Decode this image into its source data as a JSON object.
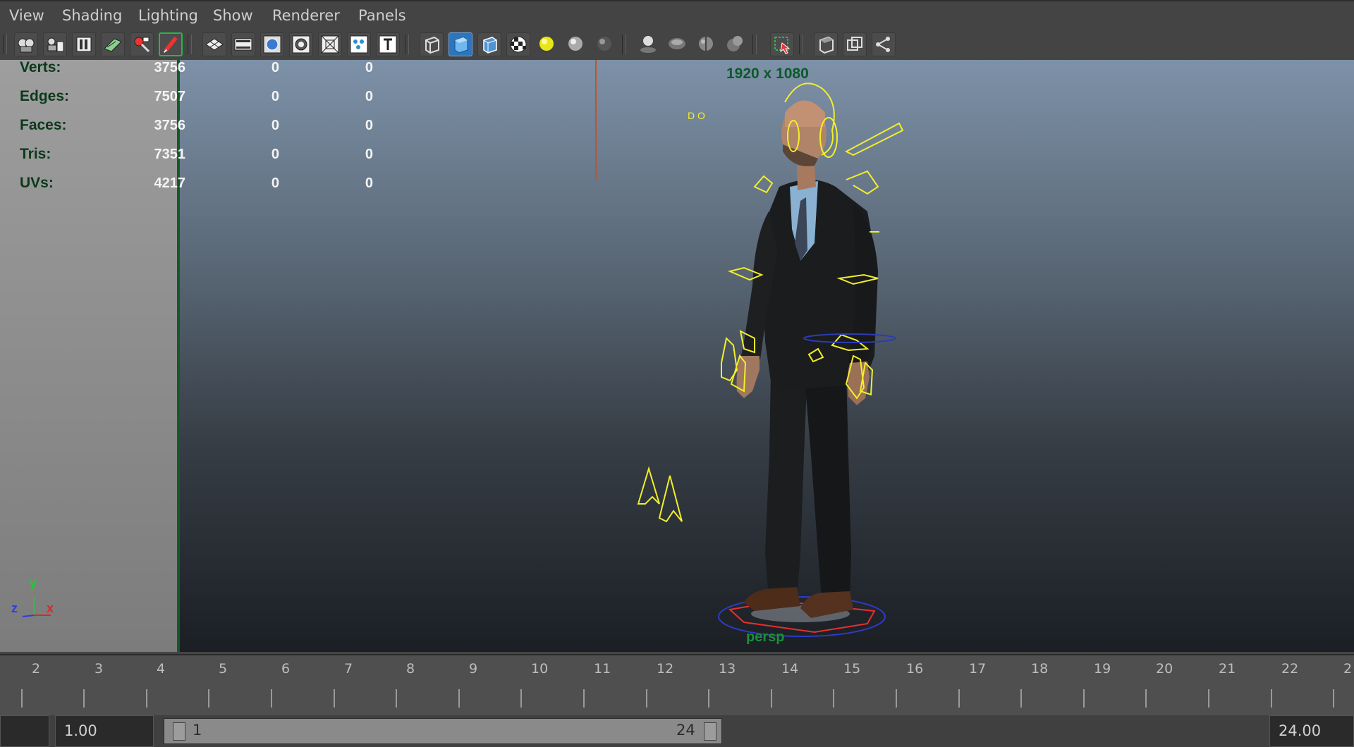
{
  "menu": [
    "View",
    "Shading",
    "Lighting",
    "Show",
    "Renderer",
    "Panels"
  ],
  "toolbar_icons": [
    "select-camera-icon",
    "camera-attributes-icon",
    "bookmarks-icon",
    "image-plane-icon",
    "2d-pan-zoom-icon",
    "grease-pencil-icon",
    "grid-icon",
    "film-gate-icon",
    "resolution-gate-icon",
    "gate-mask-icon",
    "field-chart-icon",
    "safe-action-icon",
    "safe-title-icon",
    "wireframe-icon",
    "smooth-shade-icon",
    "wireframe-on-shaded-icon",
    "textured-icon",
    "default-lighting-icon",
    "all-lights-icon",
    "flat-lighting-icon",
    "shadows-icon",
    "screen-space-ao-icon",
    "motion-blur-icon",
    "anti-aliasing-icon",
    "isolate-select-icon",
    "xray-icon",
    "xray-active-icon",
    "xray-joints-icon"
  ],
  "stats": [
    {
      "label": "Verts:",
      "v1": "3756",
      "v2": "0",
      "v3": "0"
    },
    {
      "label": "Edges:",
      "v1": "7507",
      "v2": "0",
      "v3": "0"
    },
    {
      "label": "Faces:",
      "v1": "3756",
      "v2": "0",
      "v3": "0"
    },
    {
      "label": "Tris:",
      "v1": "7351",
      "v2": "0",
      "v3": "0"
    },
    {
      "label": "UVs:",
      "v1": "4217",
      "v2": "0",
      "v3": "0"
    }
  ],
  "viewport": {
    "resolution_gate": "1920 x 1080",
    "camera_label": "persp",
    "axis": {
      "y": "y",
      "z": "z",
      "x": "x"
    },
    "extra_text": "D O"
  },
  "timeline": {
    "ticks": [
      "2",
      "3",
      "4",
      "5",
      "6",
      "7",
      "8",
      "9",
      "10",
      "11",
      "12",
      "13",
      "14",
      "15",
      "16",
      "17",
      "18",
      "19",
      "20",
      "21",
      "22",
      "2"
    ]
  },
  "range": {
    "start_time": "1.00",
    "range_start": "1",
    "range_end": "24",
    "end_time": "24.00"
  },
  "colors": {
    "rig_controls": "#f2ee2c",
    "viewport_top": "#7d91a8",
    "viewport_bottom": "#1b1f24",
    "accent_green": "#0b3a1a"
  }
}
